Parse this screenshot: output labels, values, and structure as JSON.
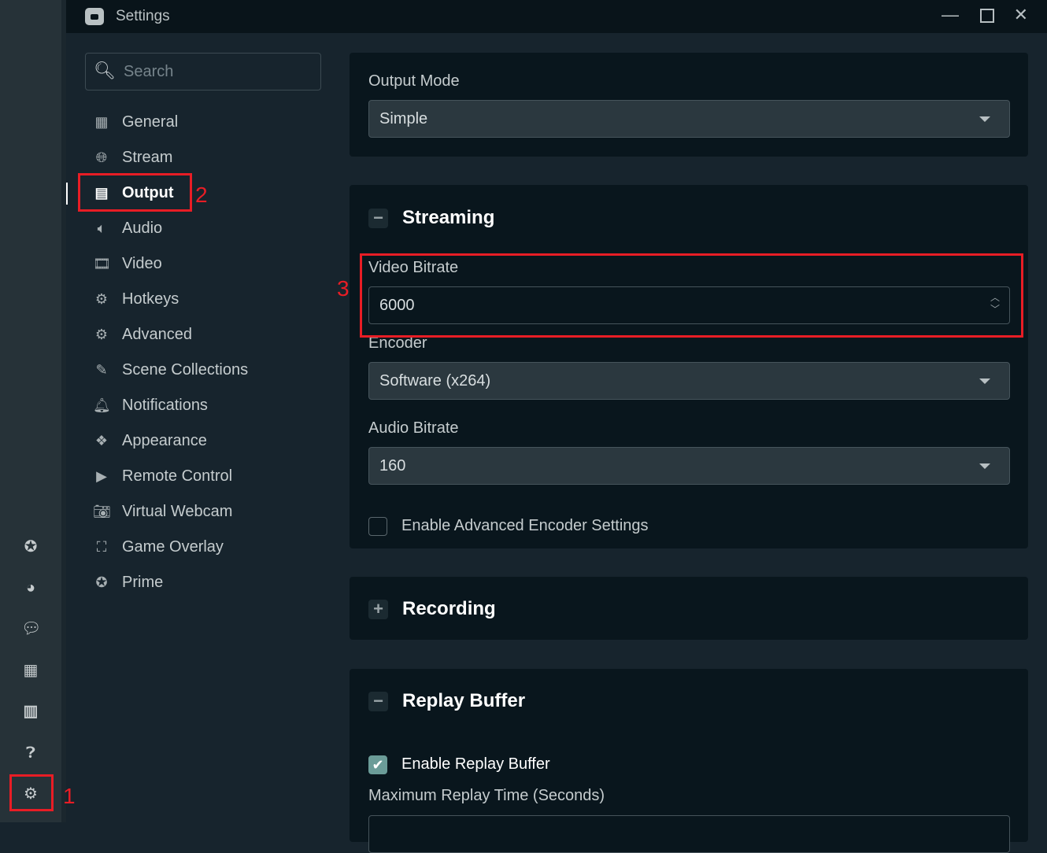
{
  "window": {
    "title": "Settings",
    "controls": [
      "minimize-icon",
      "maximize-icon",
      "close-icon"
    ]
  },
  "rail": {
    "icons": [
      "prime-icon",
      "dashboard-icon",
      "chat-icon",
      "layout-icon",
      "studio-mode-icon",
      "help-icon",
      "settings-icon"
    ]
  },
  "search": {
    "placeholder": "Search"
  },
  "nav": {
    "items": [
      {
        "label": "General",
        "icon": "grid-icon"
      },
      {
        "label": "Stream",
        "icon": "globe-icon"
      },
      {
        "label": "Output",
        "icon": "chip-icon",
        "active": true
      },
      {
        "label": "Audio",
        "icon": "speaker-icon"
      },
      {
        "label": "Video",
        "icon": "film-icon"
      },
      {
        "label": "Hotkeys",
        "icon": "gear-icon"
      },
      {
        "label": "Advanced",
        "icon": "gears-icon"
      },
      {
        "label": "Scene Collections",
        "icon": "collection-icon"
      },
      {
        "label": "Notifications",
        "icon": "bell-icon"
      },
      {
        "label": "Appearance",
        "icon": "palette-icon"
      },
      {
        "label": "Remote Control",
        "icon": "play-icon"
      },
      {
        "label": "Virtual Webcam",
        "icon": "camera-icon"
      },
      {
        "label": "Game Overlay",
        "icon": "expand-icon"
      },
      {
        "label": "Prime",
        "icon": "prime-icon"
      }
    ]
  },
  "output_mode": {
    "label": "Output Mode",
    "value": "Simple"
  },
  "streaming": {
    "title": "Streaming",
    "toggle": "−",
    "video_bitrate": {
      "label": "Video Bitrate",
      "value": "6000"
    },
    "encoder": {
      "label": "Encoder",
      "value": "Software (x264)"
    },
    "audio_bitrate": {
      "label": "Audio Bitrate",
      "value": "160"
    },
    "advanced": {
      "label": "Enable Advanced Encoder Settings",
      "checked": false
    }
  },
  "recording": {
    "title": "Recording",
    "toggle": "+"
  },
  "replay": {
    "title": "Replay Buffer",
    "toggle": "−",
    "enable": {
      "label": "Enable Replay Buffer",
      "checked": true
    },
    "max_time": {
      "label": "Maximum Replay Time (Seconds)"
    }
  },
  "annotations": [
    "1",
    "2",
    "3"
  ],
  "colors": {
    "annotation": "#e81d25",
    "checkbox_on": "#6b9c98",
    "card": "#09161d",
    "rail": "#263238"
  }
}
